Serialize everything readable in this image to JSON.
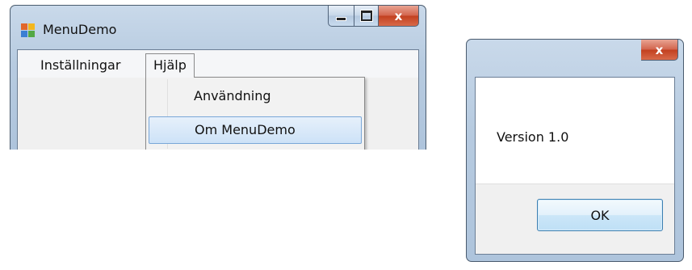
{
  "main_window": {
    "title": "MenuDemo",
    "close_glyph": "x",
    "menu": [
      {
        "label": "Inställningar"
      },
      {
        "label": "Hjälp"
      }
    ],
    "dropdown": [
      {
        "label": "Användning"
      },
      {
        "label": "Om MenuDemo",
        "highlighted": true
      }
    ]
  },
  "message_box": {
    "close_glyph": "x",
    "message": "Version 1.0",
    "ok_label": "OK"
  }
}
